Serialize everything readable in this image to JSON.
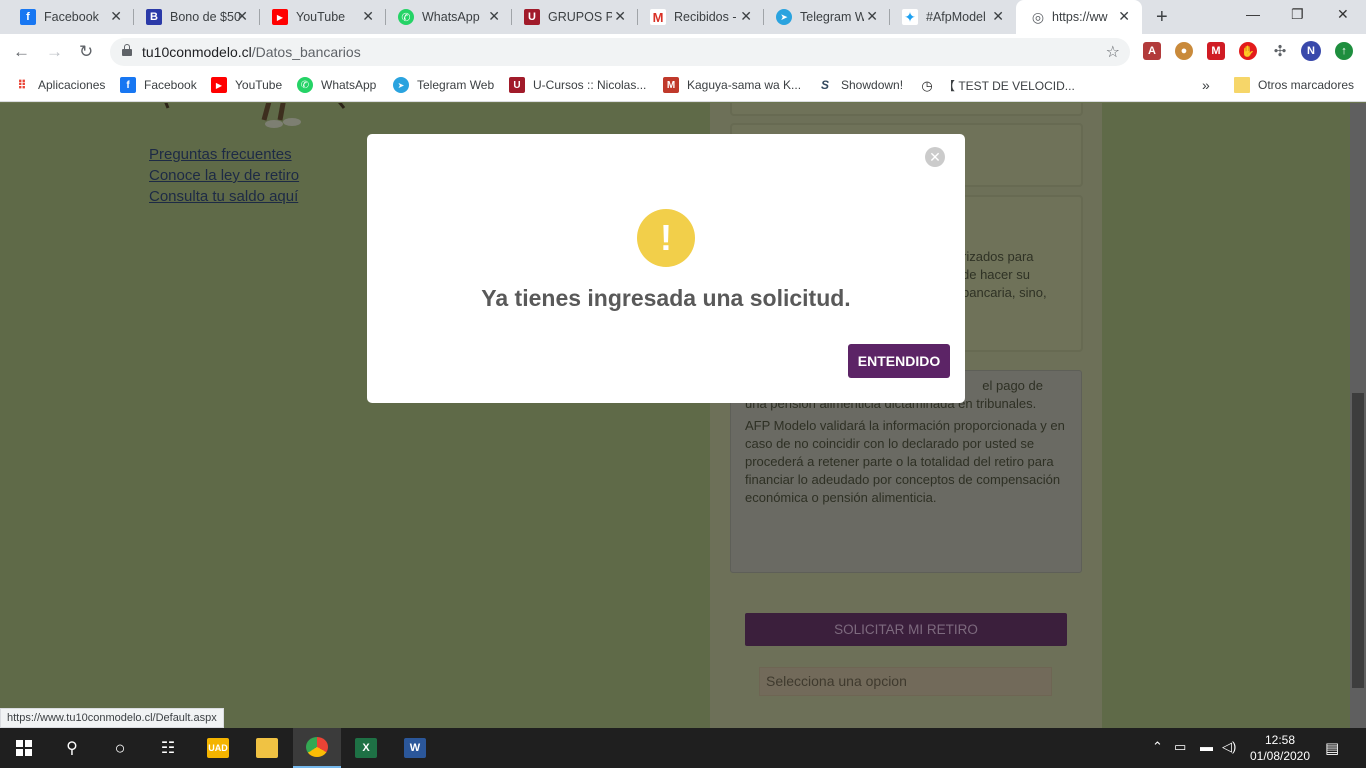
{
  "tabs": [
    {
      "title": "Facebook",
      "icon": "facebook-icon",
      "color": "#1877f2",
      "glyph": "f"
    },
    {
      "title": "Bono de $50",
      "icon": "bono-icon",
      "color": "#2b3aa8",
      "glyph": "B"
    },
    {
      "title": "YouTube",
      "icon": "youtube-icon",
      "color": "#ff0000",
      "glyph": "▶"
    },
    {
      "title": "WhatsApp",
      "icon": "whatsapp-icon",
      "color": "#25d366",
      "glyph": "✆"
    },
    {
      "title": "GRUPOS PA",
      "icon": "ucursos-icon",
      "color": "#a11b2a",
      "glyph": "U"
    },
    {
      "title": "Recibidos -",
      "icon": "gmail-icon",
      "color": "#d93025",
      "glyph": "M"
    },
    {
      "title": "Telegram W",
      "icon": "telegram-icon",
      "color": "#2aa3df",
      "glyph": "➤"
    },
    {
      "title": "#AfpModel",
      "icon": "twitter-icon",
      "color": "#1da1f2",
      "glyph": "t"
    },
    {
      "title": "https://ww",
      "icon": "globe-icon",
      "color": "#5f6368",
      "glyph": "◎"
    }
  ],
  "address": {
    "domain": "tu10conmodelo.cl",
    "path": "/Datos_bancarios"
  },
  "bookmarks": [
    {
      "label": "Aplicaciones",
      "color": "#ea4335",
      "glyph": "⋮⋮"
    },
    {
      "label": "Facebook",
      "color": "#1877f2",
      "glyph": "f"
    },
    {
      "label": "YouTube",
      "color": "#ff0000",
      "glyph": "▶"
    },
    {
      "label": "WhatsApp",
      "color": "#25d366",
      "glyph": "✆"
    },
    {
      "label": "Telegram Web",
      "color": "#2aa3df",
      "glyph": "➤"
    },
    {
      "label": "U-Cursos :: Nicolas...",
      "color": "#a11b2a",
      "glyph": "U"
    },
    {
      "label": "Kaguya-sama wa K...",
      "color": "#c0392b",
      "glyph": "M"
    },
    {
      "label": "Showdown!",
      "color": "#34495e",
      "glyph": "S"
    },
    {
      "label": "【 TEST DE VELOCID...",
      "color": "#2c2c2c",
      "glyph": "◷"
    }
  ],
  "bookmarks_more": "»",
  "other_bookmarks": "Otros marcadores",
  "left_links": [
    "Preguntas frecuentes",
    "Conoce la ley de retiro",
    "Consulta tu saldo aquí"
  ],
  "panel": {
    "fragment_lines": [
      "rizados para",
      "de hacer su",
      "bancaria, sino,"
    ],
    "note_first_line": "el pago de",
    "note_p1": "una pensión alimenticia dictaminada en tribunales.",
    "note_p2": "AFP Modelo validará la información proporcionada y en caso de no coincidir con lo declarado por usted se procederá a retener parte o la totalidad del retiro para financiar lo adeudado por conceptos de compensación económica o pensión alimenticia.",
    "button": "SOLICITAR MI RETIRO",
    "select_placeholder": "Selecciona una opcion"
  },
  "modal": {
    "title": "Ya tienes ingresada una solicitud.",
    "confirm": "ENTENDIDO",
    "icon": "warning-icon"
  },
  "status_url": "https://www.tu10conmodelo.cl/Default.aspx",
  "clock": {
    "time": "12:58",
    "date": "01/08/2020"
  },
  "profile_initial": "N"
}
